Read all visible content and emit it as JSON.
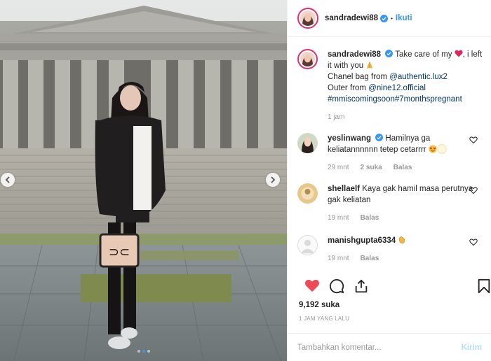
{
  "header": {
    "username": "sandradewi88",
    "separator": "•",
    "follow_label": "Ikuti"
  },
  "caption": {
    "username": "sandradewi88",
    "line1_before": "Take care of my",
    "line1_after": ", i left it with you",
    "line2_prefix": "Chanel bag from ",
    "line2_link": "@authentic.lux2",
    "line3_prefix": "Outer from ",
    "line3_link": "@nine12.official",
    "hashtags": "#mmiscomingsoon#7monthspregnant",
    "time": "1 jam"
  },
  "comments": [
    {
      "username": "yeslinwang",
      "text": "Hamilnya ga keliatannnnnn tetep cetarrrr",
      "time": "29 mnt",
      "likes": "2 suka",
      "reply": "Balas"
    },
    {
      "username": "shellaelf",
      "text": "Kaya gak hamil masa perutnya gak keliatan",
      "time": "19 mnt",
      "reply": "Balas"
    },
    {
      "username": "manishgupta6334",
      "text": "",
      "time": "19 mnt",
      "reply": "Balas"
    }
  ],
  "likes_count": "9,192 suka",
  "post_time": "1 JAM YANG LALU",
  "comment_input": {
    "placeholder": "Tambahkan komentar...",
    "post_label": "Kirim"
  },
  "icons": {
    "like": "heart-filled-icon",
    "comment": "comment-icon",
    "share": "share-icon",
    "save": "bookmark-icon",
    "verified": "verified-badge-icon"
  },
  "colors": {
    "accent": "#3897f0",
    "like": "#ed4956",
    "muted": "#999999",
    "link": "#003569"
  },
  "carousel": {
    "total_slides": 3,
    "active_slide": 2
  }
}
